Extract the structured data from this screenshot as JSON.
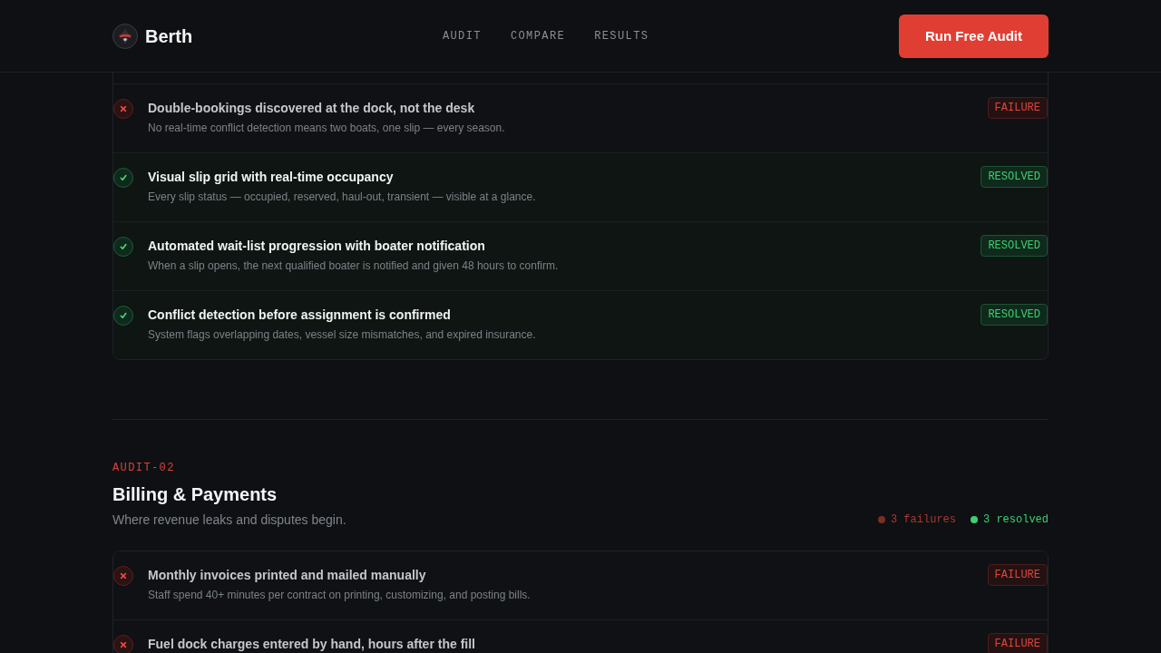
{
  "header": {
    "brand": "Berth",
    "nav": [
      {
        "label": "AUDIT"
      },
      {
        "label": "COMPARE"
      },
      {
        "label": "RESULTS"
      }
    ],
    "cta": "Run Free Audit"
  },
  "sections": [
    {
      "rows": [
        {
          "kind": "failure",
          "title": "Double-bookings discovered at the dock, not the desk",
          "description": "No real-time conflict detection means two boats, one slip — every season.",
          "badge": "FAILURE"
        },
        {
          "kind": "resolved",
          "title": "Visual slip grid with real-time occupancy",
          "description": "Every slip status — occupied, reserved, haul-out, transient — visible at a glance.",
          "badge": "RESOLVED"
        },
        {
          "kind": "resolved",
          "title": "Automated wait-list progression with boater notification",
          "description": "When a slip opens, the next qualified boater is notified and given 48 hours to confirm.",
          "badge": "RESOLVED"
        },
        {
          "kind": "resolved",
          "title": "Conflict detection before assignment is confirmed",
          "description": "System flags overlapping dates, vessel size mismatches, and expired insurance.",
          "badge": "RESOLVED"
        }
      ]
    },
    {
      "label": "AUDIT-02",
      "title": "Billing & Payments",
      "subtitle": "Where revenue leaks and disputes begin.",
      "counts": [
        {
          "kind": "failure",
          "text": "3 failures",
          "color": "#7a2e26"
        },
        {
          "kind": "resolved",
          "text": "3 resolved",
          "color": "#3ecf70"
        }
      ],
      "rows": [
        {
          "kind": "failure",
          "title": "Monthly invoices printed and mailed manually",
          "description": "Staff spend 40+ minutes per contract on printing, customizing, and posting bills.",
          "badge": "FAILURE"
        },
        {
          "kind": "failure",
          "title": "Fuel dock charges entered by hand, hours after the fill",
          "badge": "FAILURE"
        }
      ]
    }
  ]
}
